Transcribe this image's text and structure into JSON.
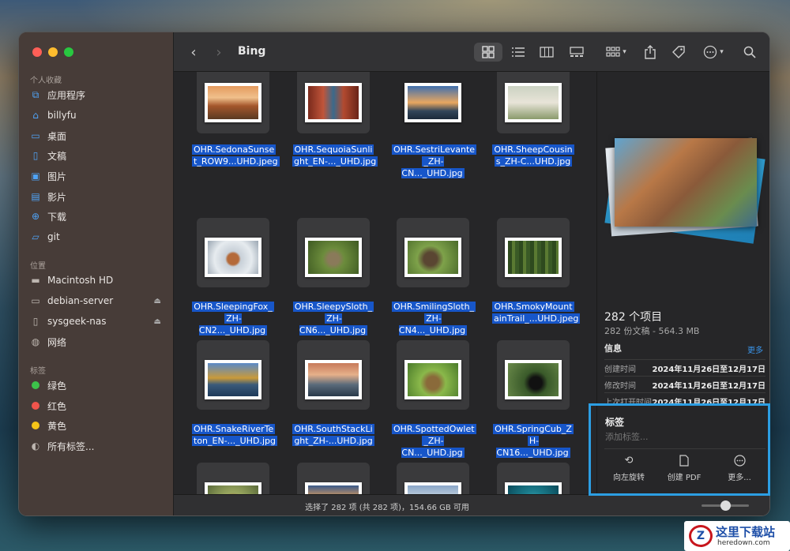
{
  "window": {
    "title": "Bing"
  },
  "sidebar": {
    "favorites_header": "个人收藏",
    "favorites": [
      {
        "label": "应用程序",
        "icon": "apps-icon"
      },
      {
        "label": "billyfu",
        "icon": "home-icon"
      },
      {
        "label": "桌面",
        "icon": "desktop-icon"
      },
      {
        "label": "文稿",
        "icon": "document-icon"
      },
      {
        "label": "图片",
        "icon": "photo-icon"
      },
      {
        "label": "影片",
        "icon": "movie-icon"
      },
      {
        "label": "下载",
        "icon": "download-icon"
      },
      {
        "label": "git",
        "icon": "folder-icon"
      }
    ],
    "locations_header": "位置",
    "locations": [
      {
        "label": "Macintosh HD",
        "icon": "disk-icon"
      },
      {
        "label": "debian-server",
        "icon": "display-icon"
      },
      {
        "label": "sysgeek-nas",
        "icon": "server-doc-icon"
      },
      {
        "label": "网络",
        "icon": "globe-icon"
      }
    ],
    "tags_header": "标签",
    "tags": [
      {
        "label": "绿色",
        "color": "#3cc34a"
      },
      {
        "label": "红色",
        "color": "#f0544c"
      },
      {
        "label": "黄色",
        "color": "#f5c518"
      },
      {
        "label": "所有标签...",
        "color": ""
      }
    ]
  },
  "files": [
    {
      "name1": "OHR.SedonaSunse",
      "name2": "t_ROW9...UHD.jpeg"
    },
    {
      "name1": "OHR.SequoiaSunli",
      "name2": "ght_EN-..._UHD.jpg"
    },
    {
      "name1": "OHR.SestriLevante",
      "name2": "_ZH-CN..._UHD.jpg"
    },
    {
      "name1": "OHR.SheepCousin",
      "name2": "s_ZH-C...UHD.jpg"
    },
    {
      "name1": "OHR.SleepingFox_",
      "name2": "ZH-CN2..._UHD.jpg"
    },
    {
      "name1": "OHR.SleepySloth_",
      "name2": "ZH-CN6..._UHD.jpg"
    },
    {
      "name1": "OHR.SmilingSloth_",
      "name2": "ZH-CN4..._UHD.jpg"
    },
    {
      "name1": "OHR.SmokyMount",
      "name2": "ainTrail_...UHD.jpeg"
    },
    {
      "name1": "OHR.SnakeRiverTe",
      "name2": "ton_EN-..._UHD.jpg"
    },
    {
      "name1": "OHR.SouthStackLi",
      "name2": "ght_ZH-...UHD.jpg"
    },
    {
      "name1": "OHR.SpottedOwlet",
      "name2": "_ZH-CN..._UHD.jpg"
    },
    {
      "name1": "OHR.SpringCub_Z",
      "name2": "H-CN16..._UHD.jpg"
    },
    {
      "name1": "",
      "name2": ""
    },
    {
      "name1": "",
      "name2": ""
    },
    {
      "name1": "",
      "name2": ""
    },
    {
      "name1": "",
      "name2": ""
    }
  ],
  "preview": {
    "count": "282 个项目",
    "subtitle": "282 份文稿 - 564.3 MB",
    "info_header": "信息",
    "more_link": "更多",
    "rows": [
      {
        "label": "创建时间",
        "value": "2024年11月26日至12月17日"
      },
      {
        "label": "修改时间",
        "value": "2024年11月26日至12月17日"
      },
      {
        "label": "上次打开时间",
        "value": "2024年11月26日至12月17日"
      }
    ],
    "tags_header": "标签",
    "tags_placeholder": "添加标签...",
    "actions": [
      {
        "label": "向左旋转",
        "icon": "rotate-left-icon"
      },
      {
        "label": "创建 PDF",
        "icon": "pdf-icon"
      },
      {
        "label": "更多...",
        "icon": "more-circle-icon"
      }
    ]
  },
  "status": {
    "text": "选择了 282 项 (共 282 项)，154.66 GB 可用",
    "zoom_level": 0.5
  },
  "watermark": {
    "text": "这里下载站",
    "sub": "heredown.com"
  }
}
